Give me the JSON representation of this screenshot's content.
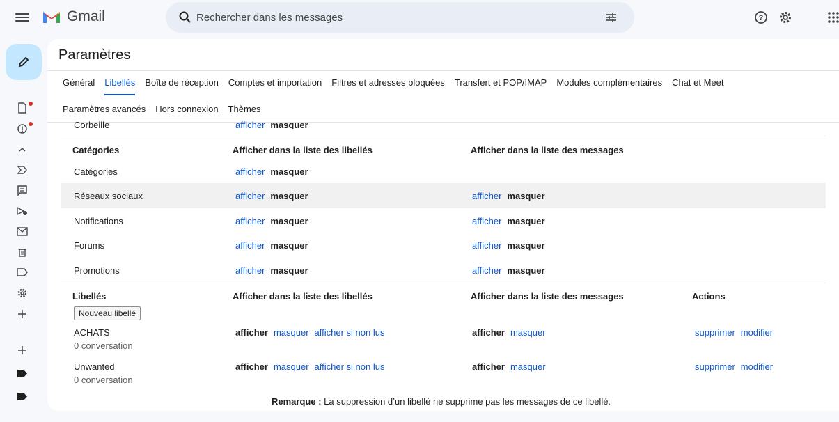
{
  "app": {
    "name": "Gmail"
  },
  "search": {
    "placeholder": "Rechercher dans les messages"
  },
  "page": {
    "title": "Paramètres"
  },
  "tabs_row1": [
    "Général",
    "Libellés",
    "Boîte de réception",
    "Comptes et importation",
    "Filtres et adresses bloquées",
    "Transfert et POP/IMAP",
    "Modules complémentaires",
    "Chat et Meet"
  ],
  "tabs_row2": [
    "Paramètres avancés",
    "Hors connexion",
    "Thèmes"
  ],
  "active_tab": "Libellés",
  "trash_row": {
    "label": "Corbeille",
    "show": "afficher",
    "hide": "masquer"
  },
  "categories_section": {
    "header": "Catégories",
    "col_list": "Afficher dans la liste des libellés",
    "col_msgs": "Afficher dans la liste des messages",
    "rows": [
      {
        "label": "Catégories",
        "list_show": "afficher",
        "list_hide": "masquer",
        "msg_show": "",
        "msg_hide": ""
      },
      {
        "label": "Réseaux sociaux",
        "list_show": "afficher",
        "list_hide": "masquer",
        "msg_show": "afficher",
        "msg_hide": "masquer"
      },
      {
        "label": "Notifications",
        "list_show": "afficher",
        "list_hide": "masquer",
        "msg_show": "afficher",
        "msg_hide": "masquer"
      },
      {
        "label": "Forums",
        "list_show": "afficher",
        "list_hide": "masquer",
        "msg_show": "afficher",
        "msg_hide": "masquer"
      },
      {
        "label": "Promotions",
        "list_show": "afficher",
        "list_hide": "masquer",
        "msg_show": "afficher",
        "msg_hide": "masquer"
      }
    ]
  },
  "labels_section": {
    "header": "Libellés",
    "col_list": "Afficher dans la liste des libellés",
    "col_msgs": "Afficher dans la liste des messages",
    "col_actions": "Actions",
    "new_label_button": "Nouveau libellé",
    "rows": [
      {
        "label": "ACHATS",
        "count": "0 conversation",
        "show": "afficher",
        "hide": "masquer",
        "show_unread": "afficher si non lus",
        "msg_show": "afficher",
        "msg_hide": "masquer",
        "delete": "supprimer",
        "edit": "modifier"
      },
      {
        "label": "Unwanted",
        "count": "0 conversation",
        "show": "afficher",
        "hide": "masquer",
        "show_unread": "afficher si non lus",
        "msg_show": "afficher",
        "msg_hide": "masquer",
        "delete": "supprimer",
        "edit": "modifier"
      }
    ]
  },
  "note": {
    "prefix": "Remarque :",
    "text": " La suppression d’un libellé ne supprime pas les messages de ce libellé."
  },
  "icons": {
    "rail": [
      "draft-icon",
      "spam-icon",
      "collapse-icon",
      "sent-icon",
      "chat-icon",
      "scheduled-icon",
      "all-mail-icon",
      "trash-icon",
      "label-outline-icon",
      "settings-icon",
      "add-icon",
      "add-label-icon",
      "label-icon",
      "label-icon"
    ]
  },
  "colors": {
    "accent": "#0b57d0",
    "compose_bg": "#c2e7ff",
    "notification_dot": "#d93025"
  }
}
